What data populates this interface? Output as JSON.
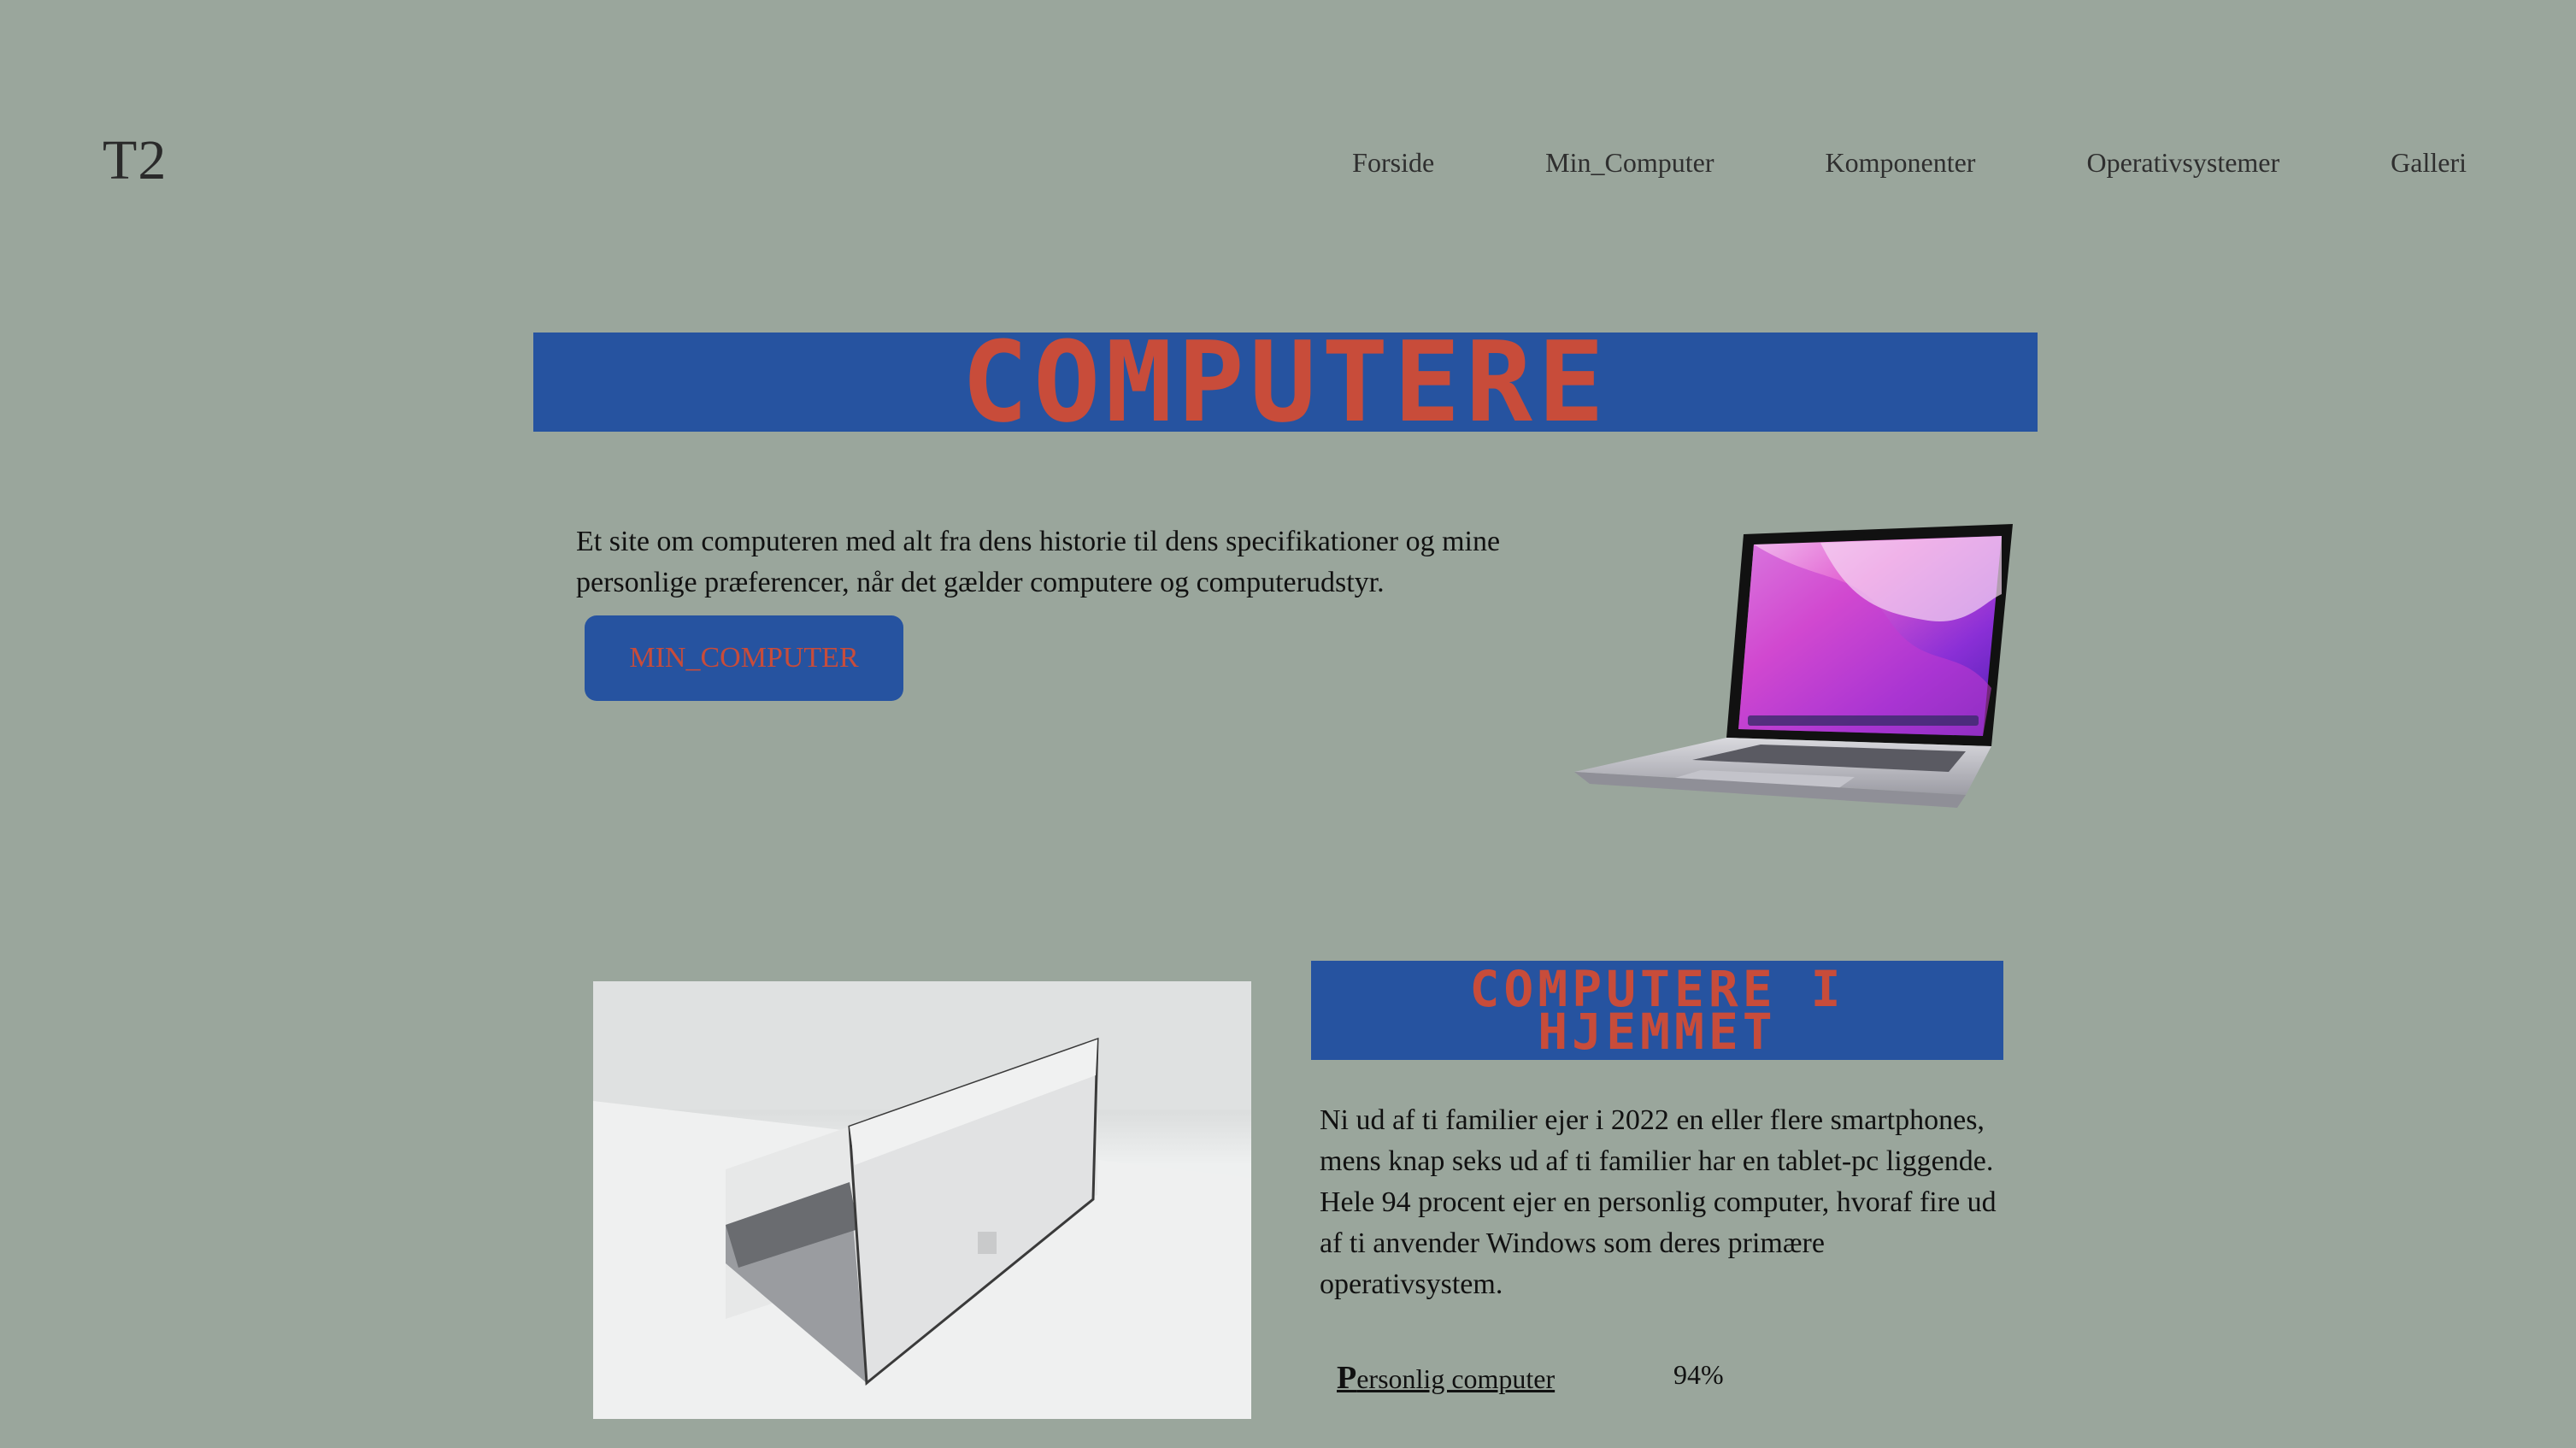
{
  "header": {
    "logo": "T2",
    "nav": [
      {
        "label": "Forside"
      },
      {
        "label": "Min_Computer"
      },
      {
        "label": "Komponenter"
      },
      {
        "label": "Operativsystemer"
      },
      {
        "label": "Galleri"
      }
    ]
  },
  "hero": {
    "title": "COMPUTERE",
    "intro": "Et site om computeren med alt fra dens historie til dens specifikationer og mine personlige præferencer, når det gælder computere og computerudstyr.",
    "button_label": "MIN_COMPUTER"
  },
  "section": {
    "title_line1": "COMPUTERE I",
    "title_line2": "HJEMMET",
    "text": "Ni ud af ti familier ejer i 2022 en eller flere smartphones, mens knap seks ud af ti familier har en tablet-pc liggende. Hele 94 procent ejer en personlig computer, hvoraf fire ud af ti anvender Windows som deres primære operativsystem.",
    "stat": {
      "label_initial": "P",
      "label_rest": "ersonlig computer",
      "value": "94%"
    }
  },
  "colors": {
    "background": "#9aa69c",
    "banner": "#2653a0",
    "accent_text": "#c84c3a"
  }
}
